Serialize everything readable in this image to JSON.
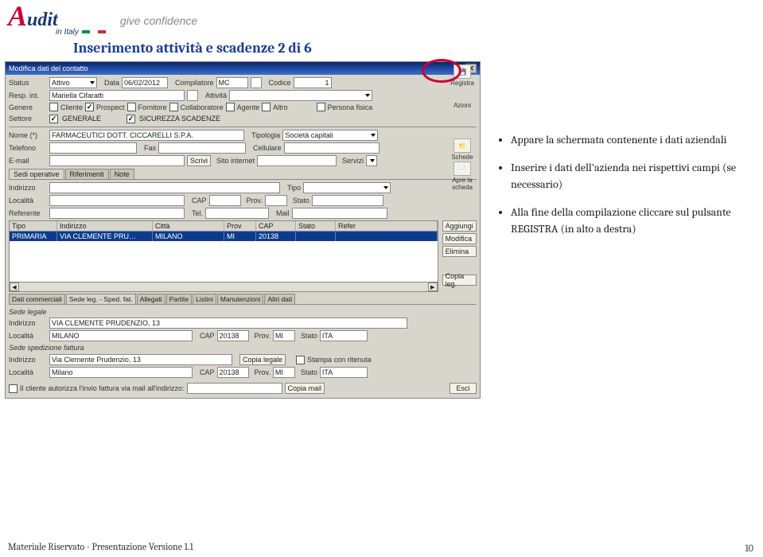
{
  "header": {
    "logo_main_a": "A",
    "logo_main_rest": "udit",
    "logo_sub": "in Italy",
    "tagline": "give confidence",
    "page_title": "Inserimento attività e scadenze 2 di 6"
  },
  "window": {
    "title": "Modifica dati del contatto",
    "row1": {
      "status_lbl": "Status",
      "status_val": "Attivo",
      "data_lbl": "Data",
      "data_val": "06/02/2012",
      "compilatore_lbl": "Compilatore",
      "compilatore_val": "MC",
      "codice_lbl": "Codice",
      "codice_val": "1"
    },
    "row2": {
      "resp_lbl": "Resp. int.",
      "resp_val": "Mariella Cifaratti",
      "attivita_lbl": "Attività"
    },
    "row3": {
      "genere_lbl": "Genere",
      "cliente": "Cliente",
      "prospect": "Prospect",
      "fornitore": "Fornitore",
      "collaboratore": "Collaboratore",
      "agente": "Agente",
      "altro": "Altro",
      "persona": "Persona fisica"
    },
    "row4": {
      "settore_lbl": "Settore",
      "opt1": "GENERALE",
      "opt2": "SICUREZZA SCADENZE"
    },
    "side": {
      "registra": "Registra",
      "azioni": "Azioni",
      "schede": "Schede",
      "apre": "Apre la scheda"
    },
    "contact": {
      "nome_lbl": "Nome (*)",
      "nome_val": "FARMACEUTICI DOTT. CICCARELLI S.P.A.",
      "tipologia_lbl": "Tipologia",
      "tipologia_val": "Società capitali",
      "telefono_lbl": "Telefono",
      "fax_lbl": "Fax",
      "cellulare_lbl": "Cellulare",
      "email_lbl": "E-mail",
      "scrivi": "Scrivi",
      "sito_lbl": "Sito internet",
      "servizi_lbl": "Servizi"
    },
    "tabs_mid": [
      "Sedi operative",
      "Riferimenti",
      "Note"
    ],
    "addr": {
      "indirizzo_lbl": "Indirizzo",
      "tipo_lbl": "Tipo",
      "localita_lbl": "Località",
      "cap_lbl": "CAP",
      "prov_lbl": "Prov.",
      "stato_lbl": "Stato",
      "referente_lbl": "Referente",
      "tel_lbl": "Tel.",
      "mail_lbl": "Mail"
    },
    "grid": {
      "headers": [
        "Tipo",
        "Indirizzo",
        "Città",
        "Prov",
        "CAP",
        "Stato",
        "Refer"
      ],
      "row": [
        "PRIMARIA",
        "VIA CLEMENTE PRU…",
        "MILANO",
        "MI",
        "20138",
        "",
        ""
      ],
      "side_btns": {
        "aggiungi": "Aggiungi",
        "modifica": "Modifica",
        "elimina": "Elimina",
        "copia": "Copia leg."
      }
    },
    "tabs_bottom": [
      "Dati commerciali",
      "Sede leg. - Sped. fat.",
      "Allegati",
      "Partite",
      "Listini",
      "Manutenzioni",
      "Altri dati"
    ],
    "legale": {
      "section1": "Sede legale",
      "indirizzo_val": "VIA CLEMENTE PRUDENZIO, 13",
      "localita_val": "MILANO",
      "cap_val": "20138",
      "prov_val": "MI",
      "stato_val": "ITA",
      "section2": "Sede spedizione fattura",
      "indirizzo2_val": "Via Clemente Prudenzio, 13",
      "copia_legale": "Copia legale",
      "stampa": "Stampa con ritenuta",
      "localita2_val": "Milano",
      "cap2_val": "20138",
      "prov2_val": "MI",
      "stato2_val": "ITA",
      "autorizza": "Il cliente autorizza l'invio fattura via mail all'indirizzo:",
      "copia_mail": "Copia mail",
      "esci": "Esci"
    }
  },
  "bullets": [
    "Appare la schermata contenente i dati aziendali",
    "Inserire i dati dell'azienda nei rispettivi campi (se necessario)",
    "Alla fine della compilazione cliccare sul pulsante REGISTRA (in alto a destra)"
  ],
  "footer": "Materiale Riservato - Presentazione Versione 1.1",
  "page_num": "10"
}
